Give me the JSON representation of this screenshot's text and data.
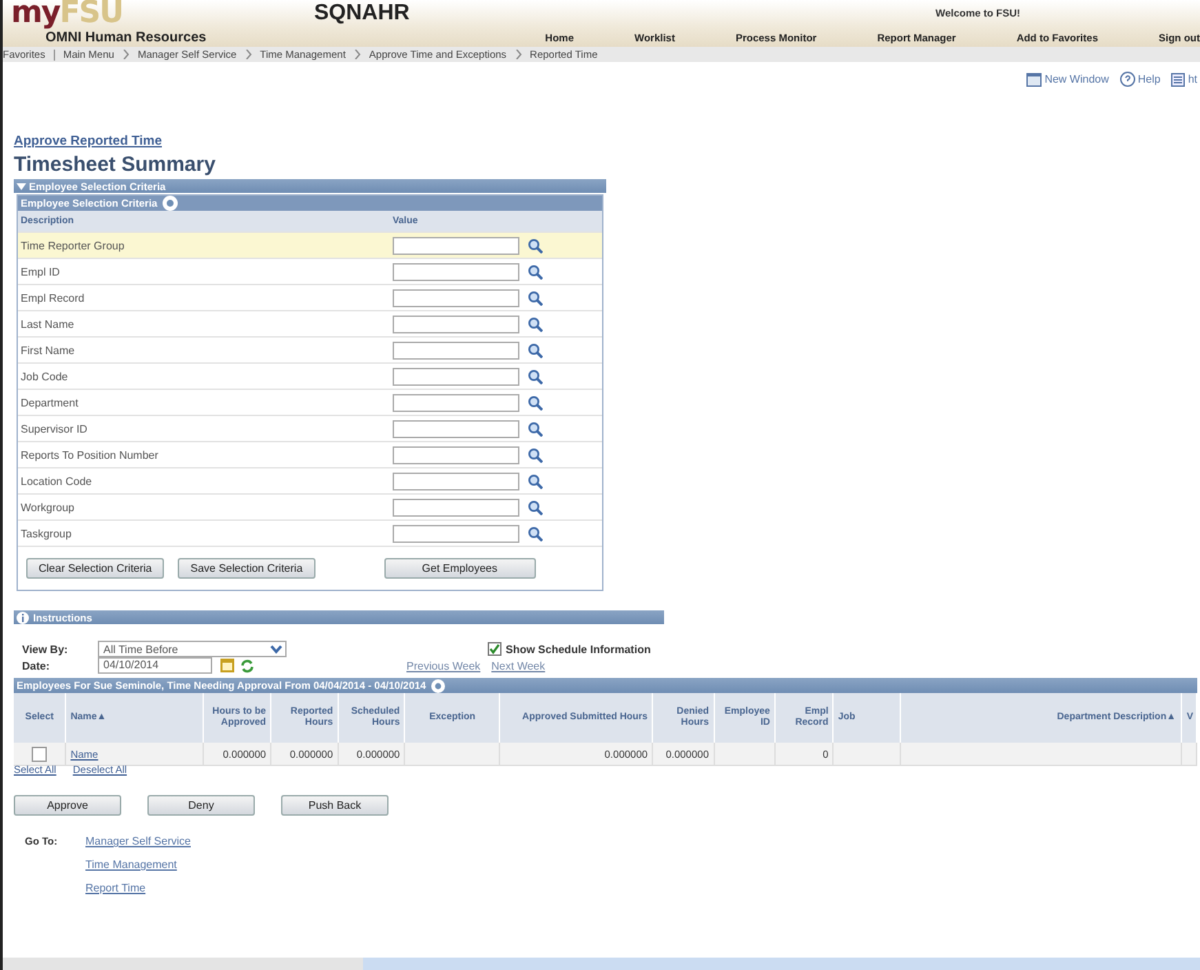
{
  "header": {
    "logo_left": "my",
    "logo_right": "FSU",
    "subtitle": "OMNI Human Resources",
    "system": "SQNAHR",
    "welcome": "Welcome to FSU!",
    "nav": [
      "Home",
      "Worklist",
      "Process Monitor",
      "Report Manager",
      "Add to Favorites",
      "Sign out"
    ]
  },
  "breadcrumbs": [
    "Favorites",
    "Main Menu",
    "Manager Self Service",
    "Time Management",
    "Approve Time and Exceptions",
    "Reported Time"
  ],
  "toolbar": [
    {
      "kind": "window",
      "label": "New Window"
    },
    {
      "kind": "help",
      "label": "Help"
    },
    {
      "kind": "page",
      "label": "ht"
    }
  ],
  "page_link": "Approve Reported Time",
  "page_title": "Timesheet Summary",
  "criteria": {
    "section": "Employee Selection Criteria",
    "expanded": true,
    "grid_title": "Employee Selection Criteria",
    "columns": [
      "Description",
      "Value"
    ],
    "rows": [
      {
        "label": "Time Reporter Group",
        "selected": true
      },
      {
        "label": "Empl ID",
        "selected": false
      },
      {
        "label": "Empl Record",
        "selected": false
      },
      {
        "label": "Last Name",
        "selected": false
      },
      {
        "label": "First Name",
        "selected": false
      },
      {
        "label": "Job Code",
        "selected": false
      },
      {
        "label": "Department",
        "selected": false
      },
      {
        "label": "Supervisor ID",
        "selected": false
      },
      {
        "label": "Reports To Position Number",
        "selected": false
      },
      {
        "label": "Location Code",
        "selected": false
      },
      {
        "label": "Workgroup",
        "selected": false
      },
      {
        "label": "Taskgroup",
        "selected": false
      }
    ],
    "buttons": [
      "Clear Selection Criteria",
      "Save Selection Criteria",
      "Get Employees"
    ]
  },
  "instructions": "Instructions",
  "view_by": {
    "label": "View By:",
    "value": "All Time Before"
  },
  "date": {
    "label": "Date:",
    "value": "04/10/2014"
  },
  "show_schedule": {
    "label": "Show Schedule Information",
    "checked": true
  },
  "week_links": [
    "Previous Week",
    "Next Week"
  ],
  "employees": {
    "title": "Employees For Sue Seminole, Time Needing Approval From 04/04/2014 - 04/10/2014",
    "columns": [
      "Select",
      "Name▲",
      "Hours to be Approved",
      "Reported Hours",
      "Scheduled Hours",
      "Exception",
      "Approved Submitted Hours",
      "Denied Hours",
      "Employee ID",
      "Empl Record",
      "Job",
      "Department Description▲",
      "V"
    ],
    "rows": [
      {
        "checked": false,
        "name": "Name",
        "hours_to_approve": "0.000000",
        "reported": "0.000000",
        "scheduled": "0.000000",
        "approved_submitted": "0.000000",
        "denied": "0.000000",
        "empl_record": "0"
      }
    ],
    "select_all": "Select All",
    "deselect_all": "Deselect All"
  },
  "actions": [
    "Approve",
    "Deny",
    "Push Back"
  ],
  "goto": {
    "label": "Go To:",
    "links": [
      "Manager Self Service",
      "Time Management",
      "Report Time"
    ]
  }
}
